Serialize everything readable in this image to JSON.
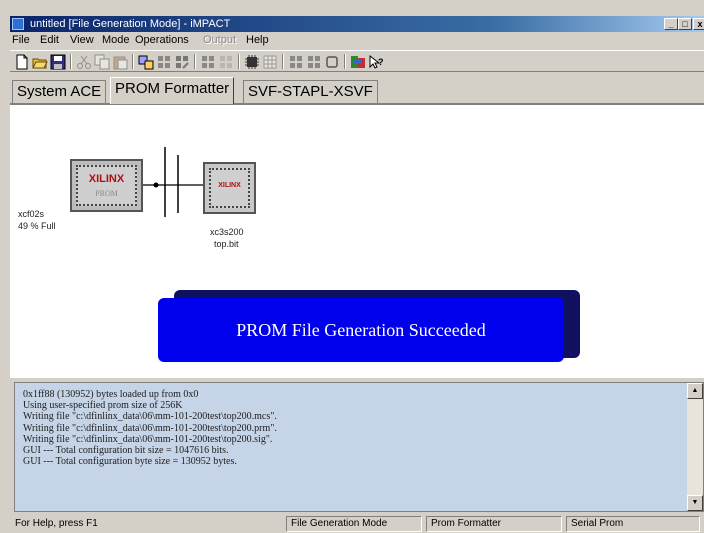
{
  "window": {
    "title": "untitled [File Generation Mode] - iMPACT",
    "controls": {
      "minimize": "_",
      "maximize": "□",
      "close": "x"
    }
  },
  "menu": {
    "file": "File",
    "edit": "Edit",
    "view": "View",
    "mode": "Mode",
    "operations": "Operations",
    "output": "Output",
    "help": "Help"
  },
  "toolbar": {
    "icons": [
      "new-icon",
      "open-icon",
      "save-icon",
      "cut-icon",
      "copy-icon",
      "paste-icon",
      "chain-icon",
      "grid-icon",
      "grid-icon",
      "grid-icon",
      "grid-icon",
      "chip-icon",
      "table-icon",
      "grid-icon",
      "grid-icon",
      "frame-icon",
      "config-icon",
      "whats-this-icon"
    ]
  },
  "tabs": {
    "system_ace": "System ACE",
    "prom_formatter": "PROM Formatter",
    "svf": "SVF-STAPL-XSVF",
    "active": "PROM Formatter"
  },
  "canvas": {
    "prom": {
      "logo": "XILINX",
      "sublabel": "PROM",
      "name": "xcf02s",
      "fill": "49 % Full"
    },
    "fpga": {
      "logo": "XILINX",
      "name": "xc3s200",
      "file": "top.bit"
    },
    "banner": "PROM File Generation Succeeded"
  },
  "log": {
    "lines": [
      "0x1ff88 (130952) bytes loaded up from 0x0",
      "Using user-specified prom size of 256K",
      "Writing file \"c:\\dfinlinx_data\\06\\mm-101-200test\\top200.mcs\".",
      "Writing file \"c:\\dfinlinx_data\\06\\mm-101-200test\\top200.prm\".",
      "Writing file \"c:\\dfinlinx_data\\06\\mm-101-200test\\top200.sig\".",
      "GUI --- Total configuration bit size = 1047616 bits.",
      "GUI --- Total configuration byte size = 130952 bytes."
    ]
  },
  "statusbar": {
    "help": "For Help, press F1",
    "mode": "File Generation Mode",
    "panel": "Prom Formatter",
    "target": "Serial Prom"
  },
  "colors": {
    "banner": "#0000ee",
    "log_background": "#c6d4e7",
    "title_gradient_start": "#0a246a"
  }
}
